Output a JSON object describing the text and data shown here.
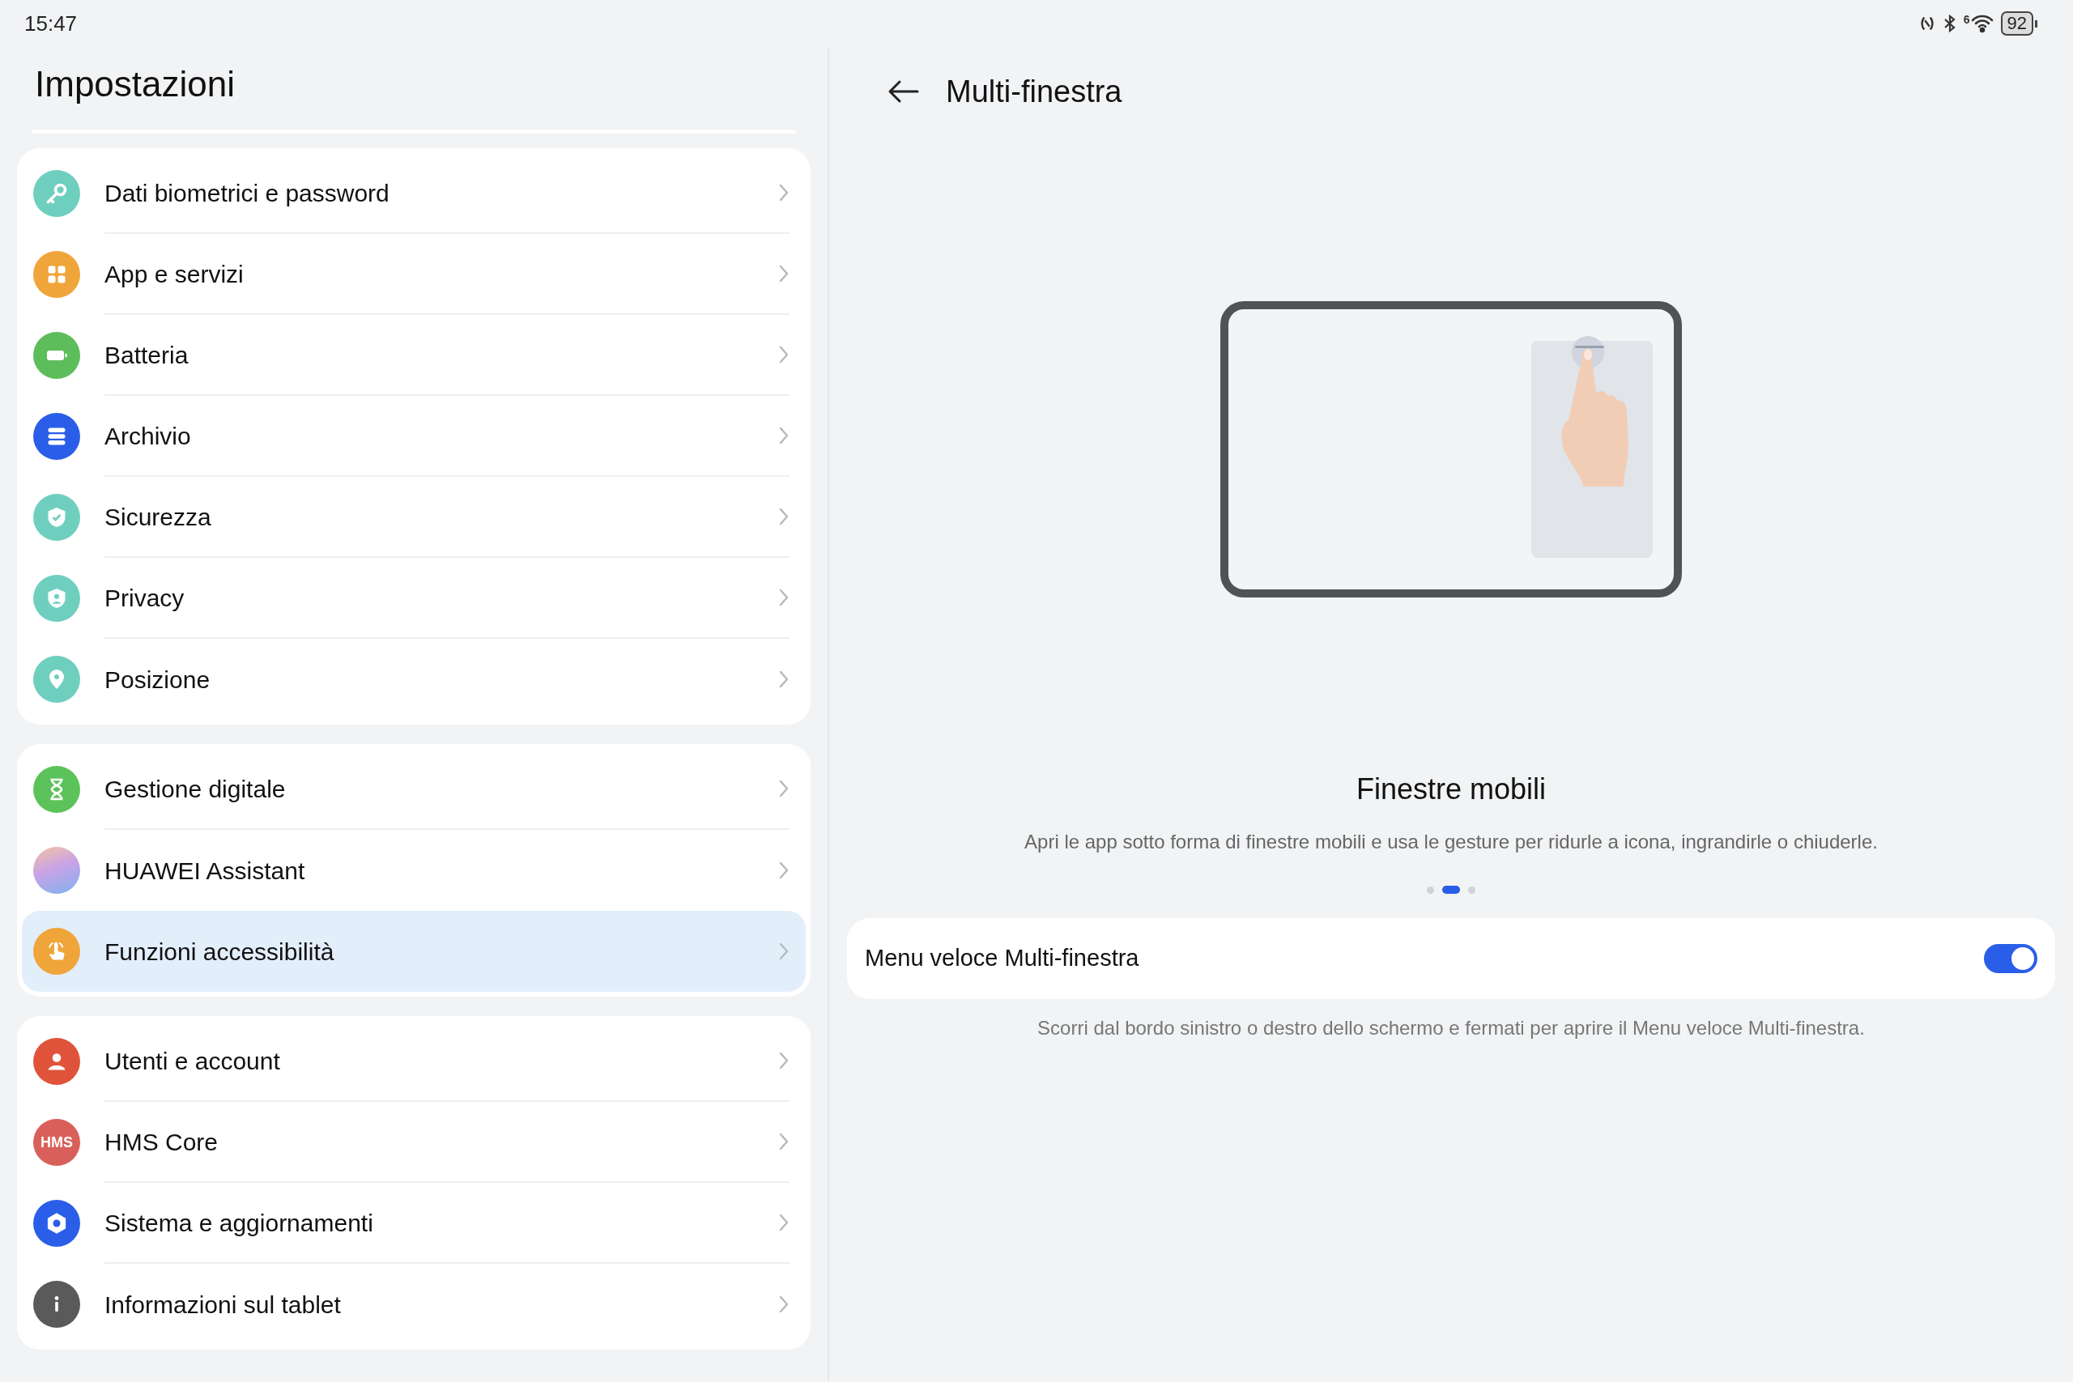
{
  "status_bar": {
    "time": "15:47",
    "wifi_generation": "6",
    "battery": "92"
  },
  "sidebar": {
    "title": "Impostazioni",
    "groups": [
      {
        "items": [
          {
            "label": "Dati biometrici e password",
            "color": "#6fcfbe",
            "selected": false
          },
          {
            "label": "App e servizi",
            "color": "#f0a53a",
            "selected": false
          },
          {
            "label": "Batteria",
            "color": "#5cbd5a",
            "selected": false
          },
          {
            "label": "Archivio",
            "color": "#2a5ee8",
            "selected": false
          },
          {
            "label": "Sicurezza",
            "color": "#6fcfbe",
            "selected": false
          },
          {
            "label": "Privacy",
            "color": "#6fcfbe",
            "selected": false
          },
          {
            "label": "Posizione",
            "color": "#6fcfbe",
            "selected": false
          }
        ]
      },
      {
        "items": [
          {
            "label": "Gestione digitale",
            "color": "#5cc35a",
            "selected": false
          },
          {
            "label": "HUAWEI Assistant",
            "color": "#c9a3e6",
            "selected": false
          },
          {
            "label": "Funzioni accessibilità",
            "color": "#f0a53a",
            "selected": true
          }
        ]
      },
      {
        "items": [
          {
            "label": "Utenti e account",
            "color": "#e0533b",
            "selected": false
          },
          {
            "label": "HMS Core",
            "color": "#d9605a",
            "icon_text": "HMS",
            "selected": false
          },
          {
            "label": "Sistema e aggiornamenti",
            "color": "#2a5ee8",
            "selected": false
          },
          {
            "label": "Informazioni sul tablet",
            "color": "#5a5a5a",
            "selected": false
          }
        ]
      }
    ]
  },
  "detail": {
    "title": "Multi-finestra",
    "feature_title": "Finestre mobili",
    "feature_description": "Apri le app sotto forma di finestre mobili e usa le gesture per ridurle a icona, ingrandirle o chiuderle.",
    "pager": [
      {
        "selected": false
      },
      {
        "selected": true
      },
      {
        "selected": false
      }
    ],
    "setting": {
      "label": "Menu veloce Multi-finestra",
      "on": true
    },
    "hint": "Scorri dal bordo sinistro o destro dello schermo e fermati per aprire il Menu veloce Multi-finestra."
  }
}
